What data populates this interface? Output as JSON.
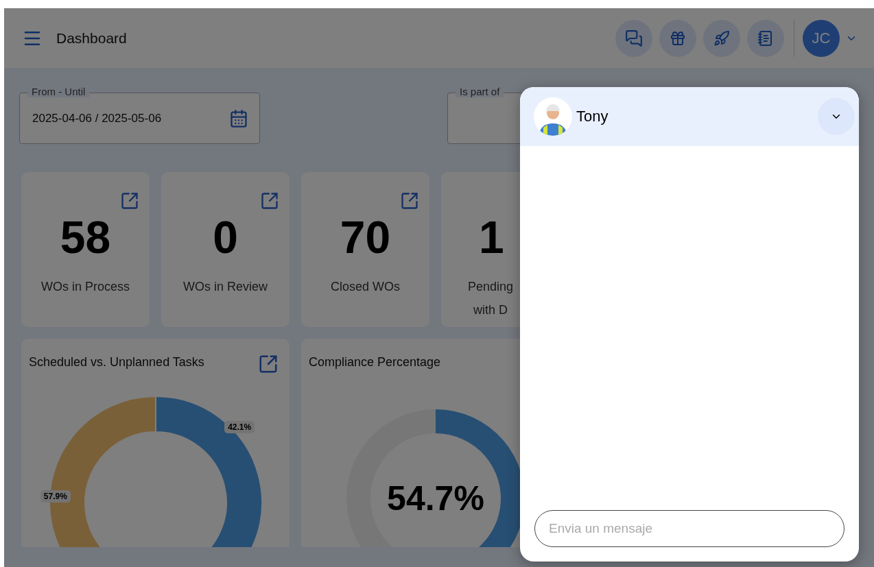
{
  "header": {
    "title": "Dashboard",
    "user_initials": "JC"
  },
  "filters": [
    {
      "kind": "date",
      "label": "From - Until",
      "value": "2025-04-06 / 2025-05-06"
    },
    {
      "kind": "select",
      "label": "Is part of"
    }
  ],
  "stats": [
    {
      "value": "58",
      "label": "WOs in Process",
      "link": true
    },
    {
      "value": "0",
      "label": "WOs in Review",
      "link": true
    },
    {
      "value": "70",
      "label": "Closed WOs",
      "link": true
    },
    {
      "value": "1",
      "label": "Pending\nwith D",
      "link": false
    }
  ],
  "scheduled_card": {
    "chart_data": {
      "type": "donut",
      "title": "Scheduled vs. Unplanned Tasks",
      "values": [
        42.1,
        57.9
      ],
      "value_labels": [
        "42.1%",
        "57.9%"
      ]
    }
  },
  "compliance_card": {
    "title": "Compliance Percentage",
    "value": "54.7%"
  },
  "chat": {
    "name": "Tony",
    "placeholder": "Envia un mensaje"
  }
}
